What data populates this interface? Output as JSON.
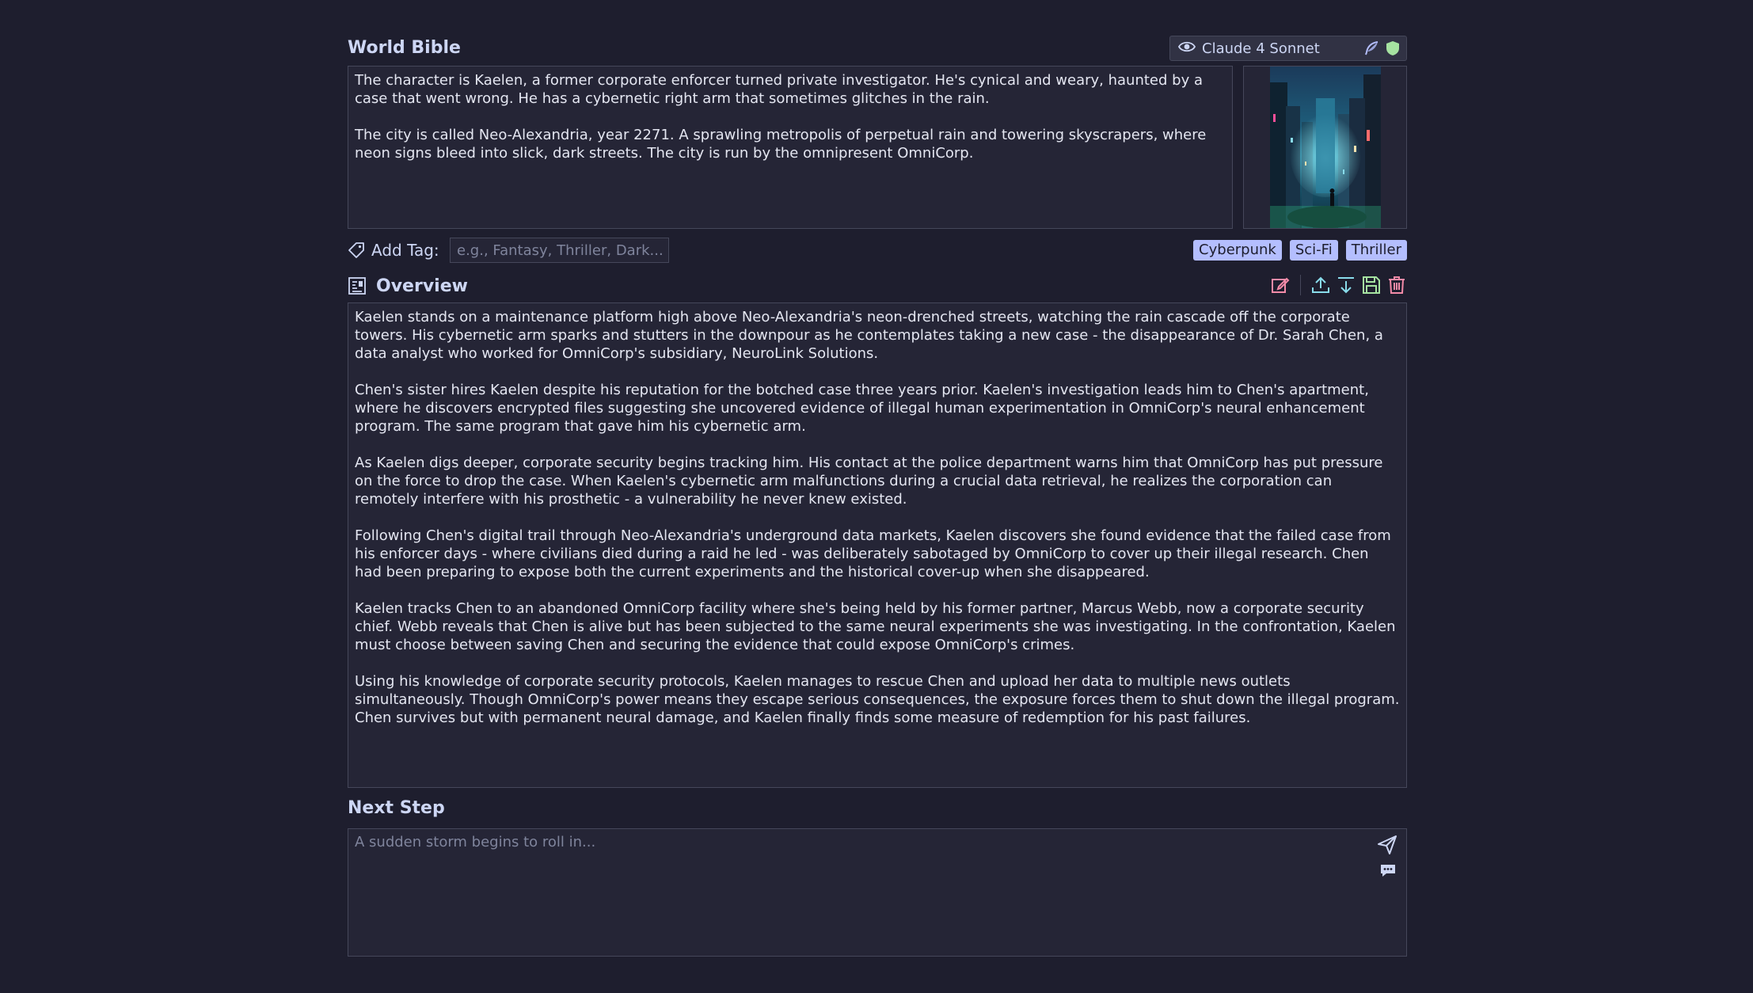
{
  "world_bible": {
    "title": "World Bible",
    "model": {
      "name": "Claude 4 Sonnet",
      "icons": [
        "eye-icon",
        "feather-icon",
        "shield-icon"
      ],
      "feather_color": "#b4befe",
      "shield_color": "#a6e3a1"
    },
    "paragraphs": [
      "The character is Kaelen, a former corporate enforcer turned private investigator. He's cynical and weary, haunted by a case that went wrong. He has a cybernetic right arm that sometimes glitches in the rain.",
      "The city is called Neo-Alexandria, year 2271. A sprawling metropolis of perpetual rain and towering skyscrapers, where neon signs bleed into slick, dark streets. The city is run by the omnipresent OmniCorp."
    ]
  },
  "tags": {
    "label": "Add Tag:",
    "placeholder": "e.g., Fantasy, Thriller, Dark...",
    "items": [
      "Cyberpunk",
      "Sci-Fi",
      "Thriller"
    ]
  },
  "overview": {
    "title": "Overview",
    "tools": [
      "edit-icon",
      "upload-icon",
      "download-icon",
      "save-icon",
      "delete-icon"
    ],
    "colors": {
      "edit": "#f38ba8",
      "upload": "#89dceb",
      "download": "#89dceb",
      "save": "#a6e3a1",
      "delete": "#f38ba8"
    },
    "paragraphs": [
      "Kaelen stands on a maintenance platform high above Neo-Alexandria's neon-drenched streets, watching the rain cascade off the corporate towers. His cybernetic arm sparks and stutters in the downpour as he contemplates taking a new case - the disappearance of Dr. Sarah Chen, a data analyst who worked for OmniCorp's subsidiary, NeuroLink Solutions.",
      "Chen's sister hires Kaelen despite his reputation for the botched case three years prior. Kaelen's investigation leads him to Chen's apartment, where he discovers encrypted files suggesting she uncovered evidence of illegal human experimentation in OmniCorp's neural enhancement program. The same program that gave him his cybernetic arm.",
      "As Kaelen digs deeper, corporate security begins tracking him. His contact at the police department warns him that OmniCorp has put pressure on the force to drop the case. When Kaelen's cybernetic arm malfunctions during a crucial data retrieval, he realizes the corporation can remotely interfere with his prosthetic - a vulnerability he never knew existed.",
      "Following Chen's digital trail through Neo-Alexandria's underground data markets, Kaelen discovers she found evidence that the failed case from his enforcer days - where civilians died during a raid he led - was deliberately sabotaged by OmniCorp to cover up their illegal research. Chen had been preparing to expose both the current experiments and the historical cover-up when she disappeared.",
      "Kaelen tracks Chen to an abandoned OmniCorp facility where she's being held by his former partner, Marcus Webb, now a corporate security chief. Webb reveals that Chen is alive but has been subjected to the same neural experiments she was investigating. In the confrontation, Kaelen must choose between saving Chen and securing the evidence that could expose OmniCorp's crimes.",
      "Using his knowledge of corporate security protocols, Kaelen manages to rescue Chen and upload her data to multiple news outlets simultaneously. Though OmniCorp's power means they escape serious consequences, the exposure forces them to shut down the illegal program. Chen survives but with permanent neural damage, and Kaelen finally finds some measure of redemption for his past failures."
    ]
  },
  "next_step": {
    "title": "Next Step",
    "placeholder": "A sudden storm begins to roll in..."
  }
}
